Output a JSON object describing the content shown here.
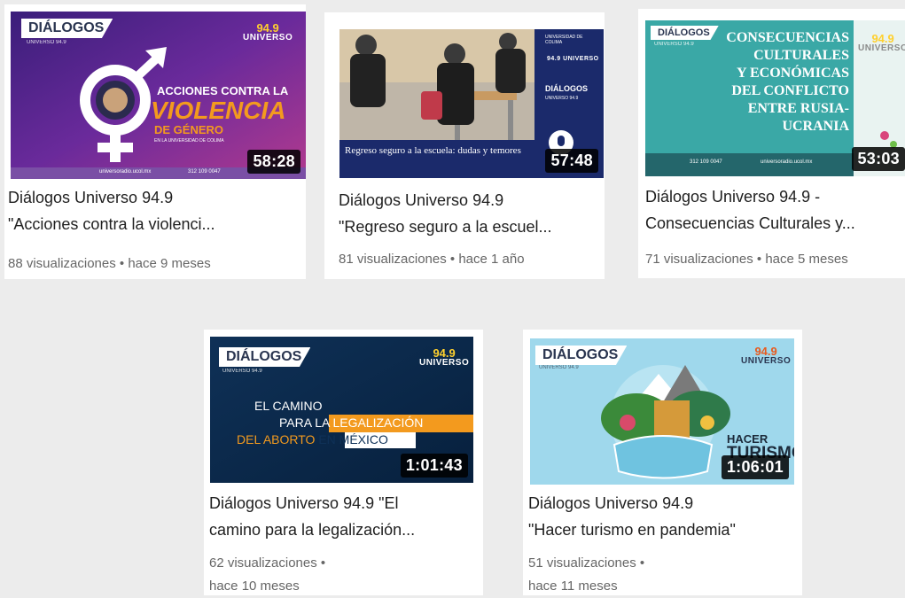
{
  "videos": [
    {
      "duration": "58:28",
      "title": "Diálogos Universo 94.9\n\"Acciones contra la violenci...",
      "meta": "88 visualizaciones • hace 9 meses",
      "thumb": {
        "badge": "DIÁLOGOS",
        "sub": "UNIVERSO 94.9",
        "logo_number": "94.9",
        "logo_word": "UNIVERSO",
        "line1": "ACCIONES CONTRA LA",
        "line2": "VIOLENCIA",
        "line3": "DE GÉNERO",
        "line4": "EN LA UNIVERSIDAD DE COLIMA",
        "footer": "universoradio.ucol.mx",
        "phone": "312 109 0047"
      }
    },
    {
      "duration": "57:48",
      "title": "Diálogos Universo 94.9\n\"Regreso seguro a la escuel...",
      "meta": "81 visualizaciones • hace 1 año",
      "thumb": {
        "caption": "Regreso seguro a la escuela: dudas y temores",
        "side1": "UNIVERSIDAD DE COLIMA",
        "side2": "94.9 UNIVERSO",
        "side3": "DIÁLOGOS",
        "side4": "UNIVERSO 94.9"
      }
    },
    {
      "duration": "53:03",
      "title": "Diálogos Universo 94.9 -\nConsecuencias Culturales y...",
      "meta": "71 visualizaciones • hace 5 meses",
      "thumb": {
        "badge": "DIÁLOGOS",
        "sub": "UNIVERSO 94.9",
        "heading": "CONSECUENCIAS\nCULTURALES\nY ECONÓMICAS\nDEL CONFLICTO\nENTRE RUSIA-UCRANIA",
        "footer": "universoradio.ucol.mx",
        "phone": "312 109 0047",
        "logo_number": "94.9",
        "logo_word": "UNIVERSO"
      }
    },
    {
      "duration": "1:01:43",
      "title": "Diálogos Universo 94.9 \"El\ncamino para la legalización...",
      "meta": "62 visualizaciones •\nhace 10 meses",
      "thumb": {
        "badge": "DIÁLOGOS",
        "sub": "UNIVERSO 94.9",
        "logo_number": "94.9",
        "logo_word": "UNIVERSO",
        "line1": "EL CAMINO",
        "line2a": "PARA LA ",
        "line2b": "LEGALIZACIÓN",
        "line3a": "DEL ABORTO ",
        "line3b": "EN MÉXICO"
      }
    },
    {
      "duration": "1:06:01",
      "title": "Diálogos Universo 94.9\n\"Hacer turismo en pandemia\"",
      "meta": "51 visualizaciones •\nhace 11 meses",
      "thumb": {
        "badge": "DIÁLOGOS",
        "sub": "UNIVERSO 94.9",
        "logo_number": "94.9",
        "logo_word": "UNIVERSO",
        "line1": "HACER",
        "line2": "TURISMO"
      }
    }
  ],
  "colors": {
    "violet": "#5b2a91",
    "orange": "#f39a1e",
    "navy": "#0d2b4e",
    "teal": "#3aa8a6",
    "sky": "#9fd8ec"
  }
}
